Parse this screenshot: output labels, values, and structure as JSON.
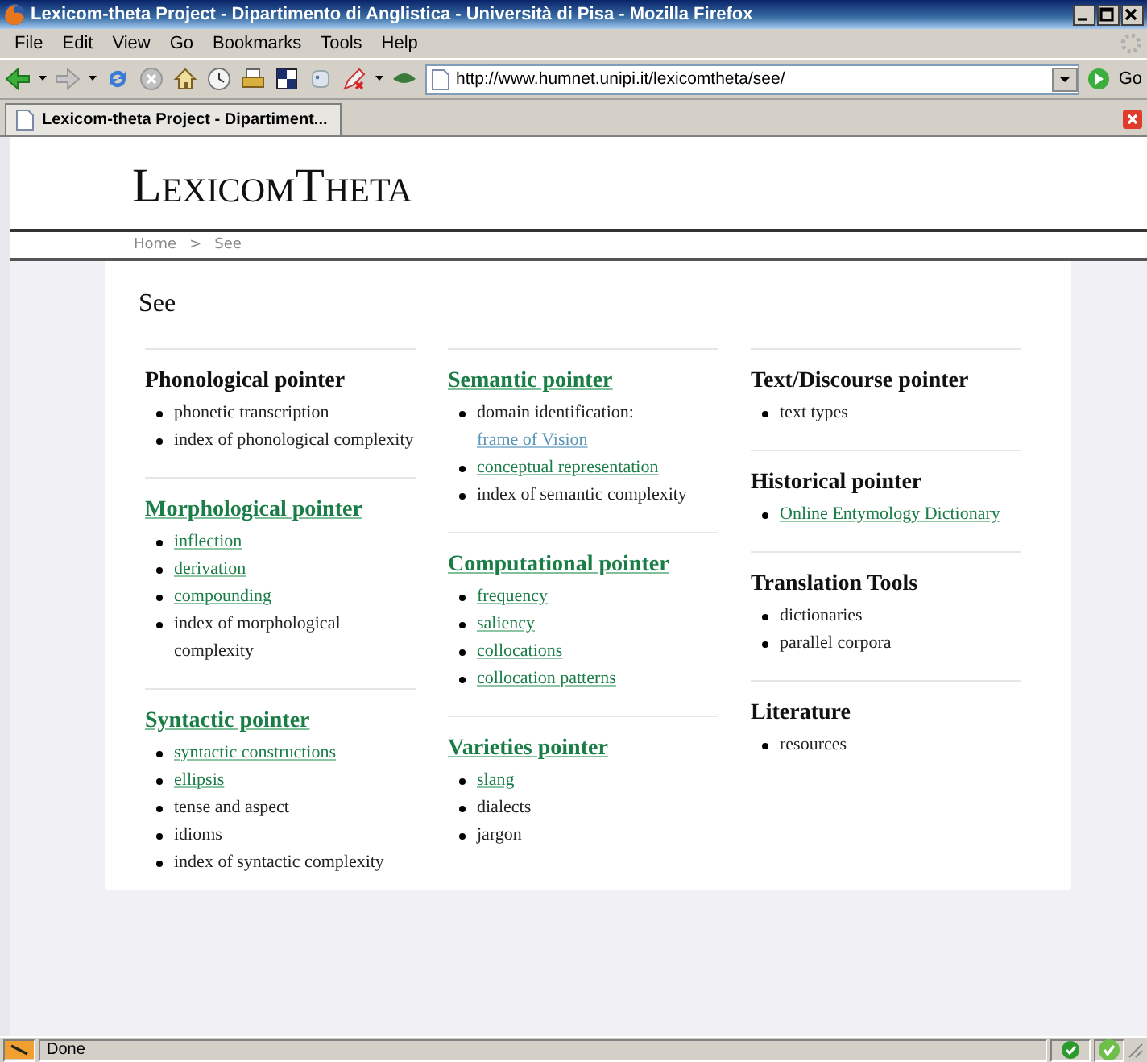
{
  "window": {
    "title": "Lexicom-theta Project - Dipartimento di Anglistica - Università  di Pisa - Mozilla Firefox"
  },
  "menu": [
    "File",
    "Edit",
    "View",
    "Go",
    "Bookmarks",
    "Tools",
    "Help"
  ],
  "address": {
    "value": "http://www.humnet.unipi.it/lexicomtheta/see/",
    "go": "Go"
  },
  "tabs": [
    {
      "label": "Lexicom-theta Project - Dipartiment...",
      "selected": true
    }
  ],
  "site": {
    "logo": "LexicomTheta",
    "breadcrumb": [
      "Home",
      "See"
    ],
    "separator": ">"
  },
  "heading": "See",
  "columns": [
    {
      "sections": [
        {
          "title": "Phonological pointer",
          "linked": false,
          "items": [
            {
              "kind": "text",
              "text": "phonetic transcription"
            },
            {
              "kind": "text",
              "text": "index of phonological complexity"
            }
          ]
        },
        {
          "title": "Morphological pointer",
          "linked": true,
          "items": [
            {
              "kind": "link",
              "text": "inflection"
            },
            {
              "kind": "link",
              "text": "derivation"
            },
            {
              "kind": "link",
              "text": "compounding"
            },
            {
              "kind": "text",
              "text": "index of morphological complexity"
            }
          ]
        },
        {
          "title": "Syntactic pointer",
          "linked": true,
          "items": [
            {
              "kind": "link",
              "text": "syntactic constructions"
            },
            {
              "kind": "link",
              "text": "ellipsis"
            },
            {
              "kind": "text",
              "text": "tense and aspect"
            },
            {
              "kind": "text",
              "text": "idioms"
            },
            {
              "kind": "text",
              "text": "index of syntactic complexity"
            }
          ]
        }
      ]
    },
    {
      "sections": [
        {
          "title": "Semantic pointer",
          "linked": true,
          "items": [
            {
              "kind": "mixed",
              "text": "domain identification:",
              "link": "frame of Vision",
              "visited": true
            },
            {
              "kind": "link",
              "text": "conceptual representation"
            },
            {
              "kind": "text",
              "text": "index of semantic complexity"
            }
          ]
        },
        {
          "title": "Computational pointer",
          "linked": true,
          "items": [
            {
              "kind": "link",
              "text": "frequency"
            },
            {
              "kind": "link",
              "text": "saliency"
            },
            {
              "kind": "link",
              "text": "collocations"
            },
            {
              "kind": "link",
              "text": "collocation patterns"
            }
          ]
        },
        {
          "title": "Varieties pointer",
          "linked": true,
          "items": [
            {
              "kind": "link",
              "text": "slang"
            },
            {
              "kind": "text",
              "text": "dialects"
            },
            {
              "kind": "text",
              "text": "jargon"
            }
          ]
        }
      ]
    },
    {
      "sections": [
        {
          "title": "Text/Discourse pointer",
          "linked": false,
          "items": [
            {
              "kind": "text",
              "text": "text types"
            }
          ]
        },
        {
          "title": "Historical pointer",
          "linked": false,
          "items": [
            {
              "kind": "link",
              "text": "Online Entymology Dictionary"
            }
          ]
        },
        {
          "title": "Translation Tools",
          "linked": false,
          "items": [
            {
              "kind": "text",
              "text": "dictionaries"
            },
            {
              "kind": "text",
              "text": "parallel corpora"
            }
          ]
        },
        {
          "title": "Literature",
          "linked": false,
          "items": [
            {
              "kind": "text",
              "text": "resources"
            }
          ]
        }
      ]
    }
  ],
  "status_bar": {
    "text": "Done"
  }
}
